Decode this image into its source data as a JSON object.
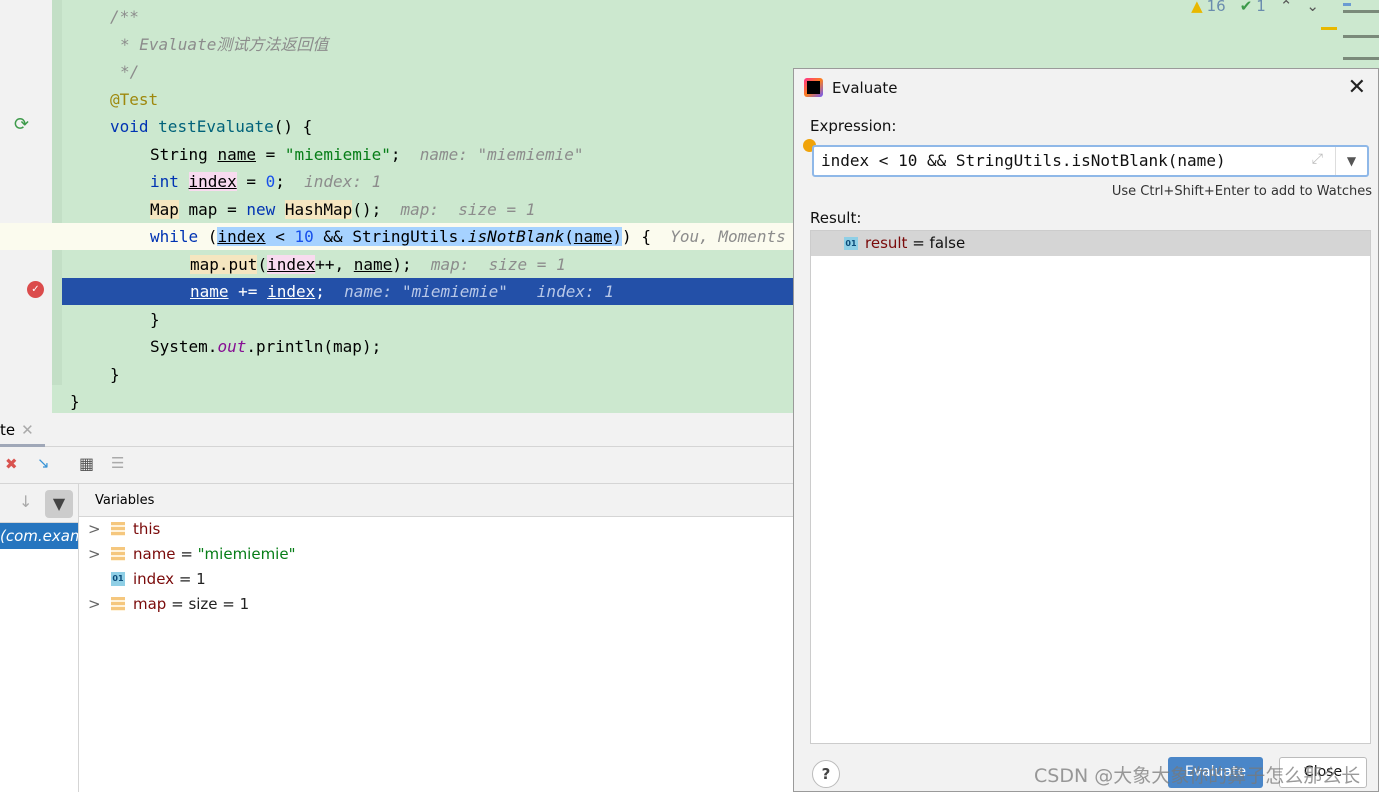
{
  "editor": {
    "status": {
      "warnings": "16",
      "checks": "1"
    },
    "lines": [
      {
        "level": 1,
        "tokens": [
          {
            "t": "/**",
            "c": "cm"
          }
        ]
      },
      {
        "level": 1,
        "pad": 1,
        "tokens": [
          {
            "t": "* Evaluate测试方法返回值",
            "c": "cm"
          }
        ]
      },
      {
        "level": 1,
        "pad": 1,
        "tokens": [
          {
            "t": "*/",
            "c": "cm"
          }
        ]
      },
      {
        "level": 1,
        "tokens": [
          {
            "t": "@Test",
            "c": "ann"
          }
        ]
      },
      {
        "level": 1,
        "tokens": [
          {
            "t": "void ",
            "c": "kw"
          },
          {
            "t": "testEvaluate",
            "c": "fn"
          },
          {
            "t": "() {",
            "c": "plain"
          }
        ]
      },
      {
        "level": 2,
        "tokens": [
          {
            "t": "String ",
            "c": "plain"
          },
          {
            "t": "name",
            "c": "plain",
            "u": true
          },
          {
            "t": " = ",
            "c": "plain"
          },
          {
            "t": "\"miemiemie\"",
            "c": "str"
          },
          {
            "t": ";  ",
            "c": "plain"
          },
          {
            "t": "name: \"miemiemie\"",
            "c": "hint"
          }
        ]
      },
      {
        "level": 2,
        "tokens": [
          {
            "t": "int ",
            "c": "kw"
          },
          {
            "t": "index",
            "c": "plain",
            "u": true,
            "hl": "pink"
          },
          {
            "t": " = ",
            "c": "plain"
          },
          {
            "t": "0",
            "c": "num"
          },
          {
            "t": ";  ",
            "c": "plain"
          },
          {
            "t": "index: 1",
            "c": "hint"
          }
        ]
      },
      {
        "level": 2,
        "tokens": [
          {
            "t": "Map",
            "c": "plain",
            "hl": "yel"
          },
          {
            "t": " map = ",
            "c": "plain"
          },
          {
            "t": "new ",
            "c": "kw"
          },
          {
            "t": "HashMap",
            "c": "plain",
            "hl": "yel"
          },
          {
            "t": "();  ",
            "c": "plain"
          },
          {
            "t": "map:  size = 1",
            "c": "hint"
          }
        ]
      },
      {
        "level": 2,
        "current": true,
        "tokens": [
          {
            "t": "while ",
            "c": "kw"
          },
          {
            "t": "(",
            "c": "plain"
          },
          {
            "t": "index",
            "c": "plain",
            "u": true,
            "hl": "sel"
          },
          {
            "t": " < ",
            "c": "plain",
            "hl": "sel"
          },
          {
            "t": "10",
            "c": "num",
            "hl": "sel"
          },
          {
            "t": " && StringUtils.",
            "c": "plain",
            "hl": "sel"
          },
          {
            "t": "isNotBlank",
            "c": "it",
            "hl": "sel"
          },
          {
            "t": "(",
            "c": "plain",
            "hl": "sel"
          },
          {
            "t": "name",
            "c": "plain",
            "u": true,
            "hl": "sel"
          },
          {
            "t": ")",
            "c": "plain",
            "hl": "sel"
          },
          {
            "t": ") {  ",
            "c": "plain"
          },
          {
            "t": "You, Moments ago",
            "c": "hint"
          }
        ]
      },
      {
        "level": 3,
        "tokens": [
          {
            "t": "map.put",
            "c": "plain",
            "hl": "yel"
          },
          {
            "t": "(",
            "c": "plain"
          },
          {
            "t": "index",
            "c": "plain",
            "u": true,
            "hl": "pink"
          },
          {
            "t": "++, ",
            "c": "plain"
          },
          {
            "t": "name",
            "c": "plain",
            "u": true
          },
          {
            "t": ");  ",
            "c": "plain"
          },
          {
            "t": "map:  size = 1",
            "c": "hint"
          }
        ]
      },
      {
        "level": 3,
        "selected": true,
        "tokens": [
          {
            "t": "name",
            "c": "plain",
            "u": true
          },
          {
            "t": " += ",
            "c": "plain"
          },
          {
            "t": "index",
            "c": "plain",
            "u": true
          },
          {
            "t": ";  ",
            "c": "plain"
          },
          {
            "t": "name: \"miemiemie\"   index: 1",
            "c": "hint"
          }
        ]
      },
      {
        "level": 2,
        "tokens": [
          {
            "t": "}",
            "c": "plain"
          }
        ]
      },
      {
        "level": 2,
        "tokens": [
          {
            "t": "System.",
            "c": "plain"
          },
          {
            "t": "out",
            "c": "field"
          },
          {
            "t": ".println(map);",
            "c": "plain"
          }
        ]
      },
      {
        "level": 1,
        "tokens": [
          {
            "t": "}",
            "c": "plain"
          }
        ]
      },
      {
        "level": 0,
        "tokens": [
          {
            "t": "}",
            "c": "plain"
          }
        ]
      }
    ]
  },
  "debug": {
    "tab_label": "te",
    "frame_label": "(com.example",
    "variables_header": "Variables",
    "variables": [
      {
        "name": "this",
        "value": "",
        "type": "object",
        "expandable": true
      },
      {
        "name": "name",
        "value": "\"miemiemie\"",
        "type": "string",
        "expandable": true
      },
      {
        "name": "index",
        "value": "1",
        "type": "primitive",
        "expandable": false
      },
      {
        "name": "map",
        "value": " size = 1",
        "type": "object",
        "expandable": true
      }
    ]
  },
  "dialog": {
    "title": "Evaluate",
    "expression_label": "Expression:",
    "expression": "index < 10 && StringUtils.isNotBlank(name)",
    "hint": "Use Ctrl+Shift+Enter to add to Watches",
    "result_label": "Result:",
    "result_name": "result",
    "result_value": " = false",
    "evaluate_label": "Evaluate",
    "close_label": "Close",
    "help_label": "?",
    "primitive_badge": "01"
  },
  "watermark": "CSDN @大象大象你的鼻子怎么那么长"
}
